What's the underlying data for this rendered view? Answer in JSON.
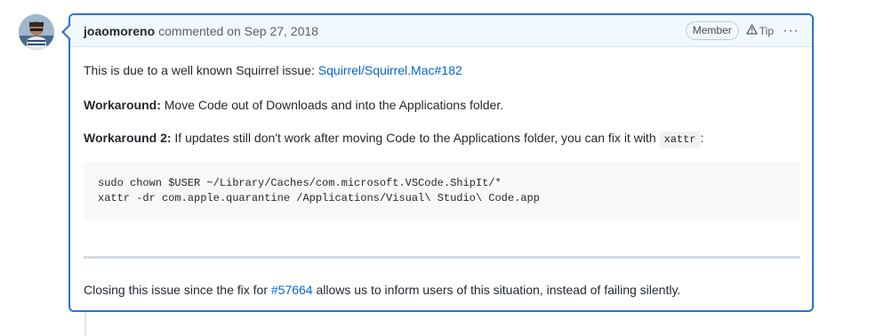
{
  "comment": {
    "author": "joaomoreno",
    "action": "commented on",
    "date": "Sep 27, 2018",
    "badge": "Member",
    "tip": "Tip",
    "more": "···"
  },
  "body": {
    "p1": {
      "text": "This is due to a well known Squirrel issue: ",
      "link": "Squirrel/Squirrel.Mac#182"
    },
    "p2": {
      "bold": "Workaround:",
      "text": " Move Code out of Downloads and into the Applications folder."
    },
    "p3": {
      "bold": "Workaround 2:",
      "text": " If updates still don't work after moving Code to the Applications folder, you can fix it with ",
      "code": "xattr",
      "end": ":"
    },
    "code_lines": [
      "sudo chown $USER ~/Library/Caches/com.microsoft.VSCode.ShipIt/*",
      "xattr -dr com.apple.quarantine /Applications/Visual\\ Studio\\ Code.app"
    ],
    "p4": {
      "text_before": "Closing this issue since the fix for ",
      "link": "#57664",
      "text_after": " allows us to inform users of this situation, instead of failing silently."
    }
  },
  "colors": {
    "border_accent": "#2c72d4",
    "header_bg": "#f1f8ff",
    "link": "#0366d6"
  },
  "icons": {
    "avatar": "user-avatar",
    "tip": "alert-triangle-icon",
    "more": "kebab-horizontal-icon"
  }
}
